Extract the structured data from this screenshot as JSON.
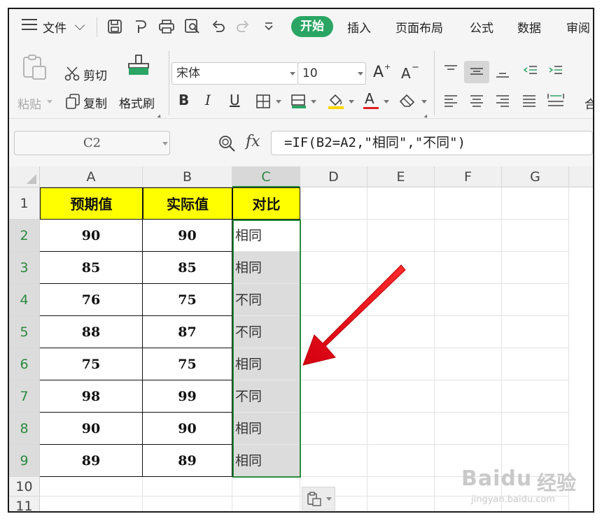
{
  "menubar": {
    "file_label": "文件",
    "tabs": [
      "开始",
      "插入",
      "页面布局",
      "公式",
      "数据",
      "审阅"
    ]
  },
  "ribbon": {
    "paste_label": "粘贴",
    "cut_label": "剪切",
    "copy_label": "复制",
    "format_painter_label": "格式刷",
    "font_name": "宋体",
    "font_size": "10",
    "bold_label": "B",
    "italic_label": "I",
    "underline_label": "U",
    "font_color_label": "A",
    "increase_font_label": "A",
    "decrease_font_label": "A",
    "merge_partial": "合"
  },
  "formula_bar": {
    "name_box": "C2",
    "fx_label": "fx",
    "formula": "=IF(B2=A2,\"相同\",\"不同\")"
  },
  "sheet": {
    "columns": [
      "A",
      "B",
      "C",
      "D",
      "E",
      "F",
      "G"
    ],
    "rows": [
      "1",
      "2",
      "3",
      "4",
      "5",
      "6",
      "7",
      "8",
      "9",
      "10",
      "11"
    ],
    "headers": [
      "预期值",
      "实际值",
      "对比"
    ],
    "data": [
      [
        "90",
        "90",
        "相同"
      ],
      [
        "85",
        "85",
        "相同"
      ],
      [
        "76",
        "75",
        "不同"
      ],
      [
        "88",
        "87",
        "不同"
      ],
      [
        "75",
        "75",
        "相同"
      ],
      [
        "98",
        "99",
        "不同"
      ],
      [
        "90",
        "90",
        "相同"
      ],
      [
        "89",
        "89",
        "相同"
      ]
    ]
  },
  "watermark": {
    "brand": "Baidu",
    "brand_cn": "经验",
    "url": "jingyan.baidu.com"
  },
  "colors": {
    "accent_green": "#2aa564",
    "selection_green": "#2a8a3e",
    "header_fill": "#ffff00",
    "arrow_red": "#e60012"
  }
}
